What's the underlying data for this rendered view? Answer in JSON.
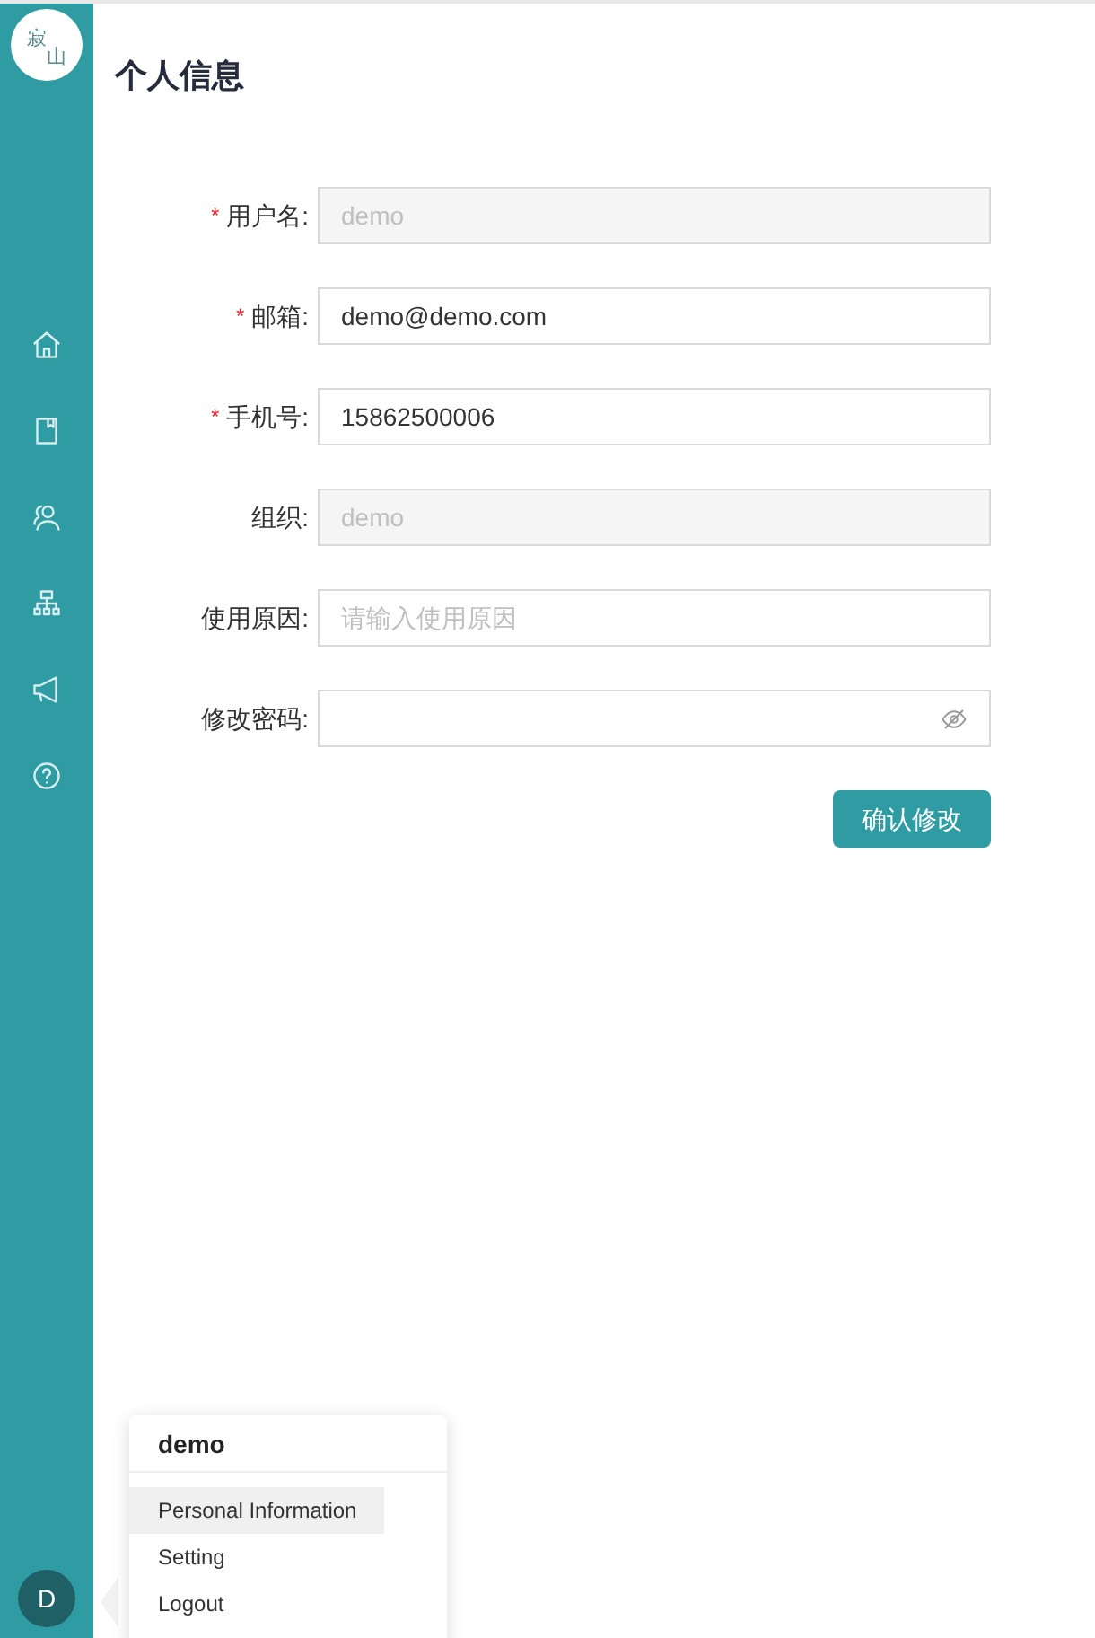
{
  "logo": {
    "chars": [
      "寂",
      "山"
    ]
  },
  "sidebar": {
    "avatar": "D"
  },
  "page_title": "个人信息",
  "form": {
    "fields": [
      {
        "required_mark": "*",
        "label": "用户名:",
        "kind": "text",
        "value": "demo",
        "disabled": true
      },
      {
        "required_mark": "*",
        "label": "邮箱:",
        "kind": "text",
        "value": "demo@demo.com",
        "disabled": false
      },
      {
        "required_mark": "*",
        "label": "手机号:",
        "kind": "text",
        "value": "15862500006",
        "disabled": false
      },
      {
        "label": "组织:",
        "kind": "text",
        "value": "demo",
        "disabled": true
      },
      {
        "label": "使用原因:",
        "kind": "text",
        "placeholder": "请输入使用原因",
        "disabled": false
      },
      {
        "label": "修改密码:",
        "kind": "password",
        "disabled": false
      }
    ],
    "submit": "确认修改"
  },
  "user_menu": {
    "name": "demo",
    "items": [
      {
        "label": "Personal Information",
        "selected": true
      },
      {
        "label": "Setting",
        "selected": false
      },
      {
        "label": "Logout",
        "selected": false
      }
    ]
  }
}
